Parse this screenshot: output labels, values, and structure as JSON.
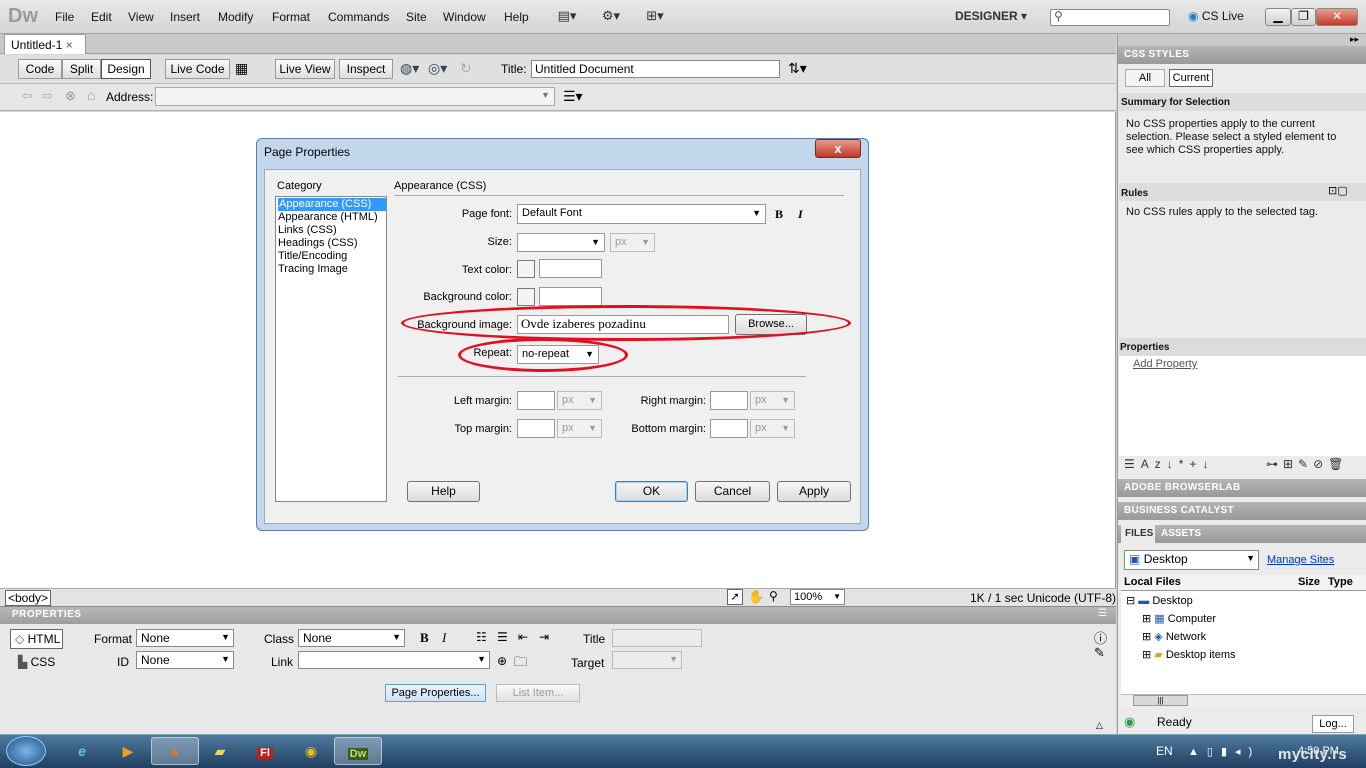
{
  "app": {
    "logo": "Dw",
    "workspace": "DESIGNER",
    "cs_live": "CS Live"
  },
  "menu": [
    "File",
    "Edit",
    "View",
    "Insert",
    "Modify",
    "Format",
    "Commands",
    "Site",
    "Window",
    "Help"
  ],
  "doc_tab": {
    "label": "Untitled-1",
    "close": "×"
  },
  "doc_toolbar": {
    "code": "Code",
    "split": "Split",
    "design": "Design",
    "live_code": "Live Code",
    "live_view": "Live View",
    "inspect": "Inspect",
    "title_label": "Title:",
    "title_value": "Untitled Document"
  },
  "address": {
    "label": "Address:",
    "value": ""
  },
  "status": {
    "tag": "<body>",
    "zoom": "100%",
    "info": "1K / 1 sec  Unicode (UTF-8)"
  },
  "properties": {
    "header": "PROPERTIES",
    "html_btn": "HTML",
    "css_btn": "CSS",
    "format_label": "Format",
    "format_value": "None",
    "id_label": "ID",
    "id_value": "None",
    "class_label": "Class",
    "class_value": "None",
    "link_label": "Link",
    "link_value": "",
    "title_label": "Title",
    "target_label": "Target",
    "page_props_btn": "Page Properties...",
    "list_item_btn": "List Item..."
  },
  "css_panel": {
    "header": "CSS STYLES",
    "tab_all": "All",
    "tab_current": "Current",
    "summary_title": "Summary for Selection",
    "summary_text": "No CSS properties apply to the current selection.  Please select a styled element to see which CSS properties apply.",
    "rules_title": "Rules",
    "rules_text": "No CSS rules apply to the selected tag.",
    "properties_title": "Properties",
    "add_property": "Add Property"
  },
  "browserlab": "ADOBE BROWSERLAB",
  "business_catalyst": "BUSINESS CATALYST",
  "files_panel": {
    "tab_files": "FILES",
    "tab_assets": "ASSETS",
    "location": "Desktop",
    "manage_sites": "Manage Sites",
    "col_local": "Local Files",
    "col_size": "Size",
    "col_type": "Type",
    "tree": [
      "Desktop",
      "Computer",
      "Network",
      "Desktop items"
    ],
    "status": "Ready",
    "log_btn": "Log..."
  },
  "dialog": {
    "title": "Page Properties",
    "close": "x",
    "category_label": "Category",
    "categories": [
      "Appearance (CSS)",
      "Appearance (HTML)",
      "Links (CSS)",
      "Headings (CSS)",
      "Title/Encoding",
      "Tracing Image"
    ],
    "section_title": "Appearance (CSS)",
    "page_font_label": "Page font:",
    "page_font_value": "Default Font",
    "bold": "B",
    "italic": "I",
    "size_label": "Size:",
    "size_unit": "px",
    "text_color_label": "Text color:",
    "bg_color_label": "Background color:",
    "bg_image_label": "Background image:",
    "bg_image_value": "Ovde izaberes pozadinu",
    "browse_btn": "Browse...",
    "repeat_label": "Repeat:",
    "repeat_value": "no-repeat",
    "left_margin_label": "Left margin:",
    "right_margin_label": "Right margin:",
    "top_margin_label": "Top margin:",
    "bottom_margin_label": "Bottom margin:",
    "margin_unit": "px",
    "help_btn": "Help",
    "ok_btn": "OK",
    "cancel_btn": "Cancel",
    "apply_btn": "Apply"
  },
  "taskbar": {
    "lang": "EN",
    "time": "4:50 PM"
  },
  "watermark": "mycity.rs",
  "colors": {
    "annotation": "#e01020",
    "selection": "#3399ff",
    "link": "#0033cc"
  }
}
